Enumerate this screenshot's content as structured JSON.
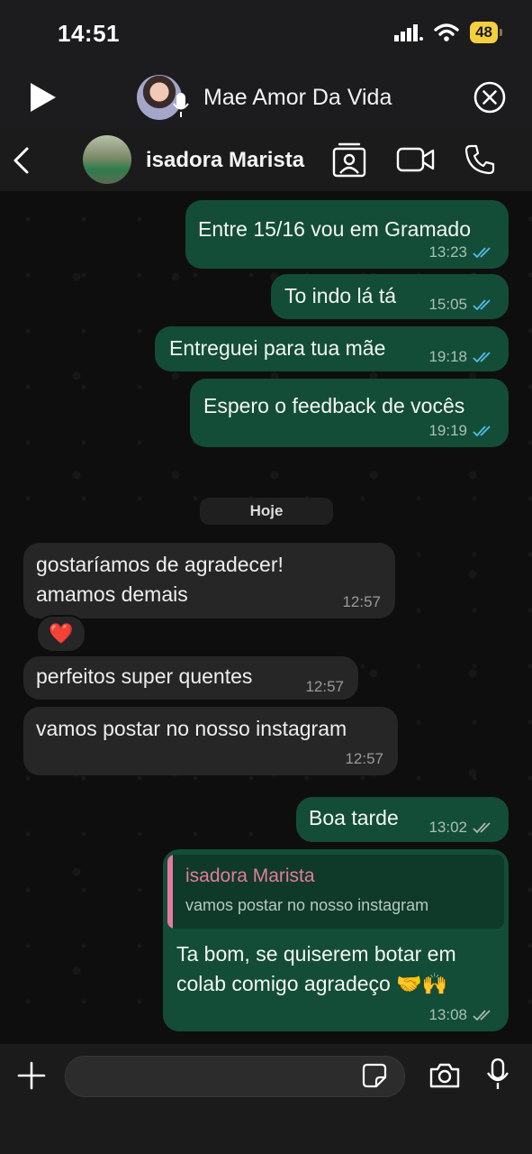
{
  "status_bar": {
    "time": "14:51",
    "battery": "48"
  },
  "call_banner": {
    "name": "Mae Amor Da Vida"
  },
  "header": {
    "contact_name": "isadora Marista"
  },
  "messages": [
    {
      "dir": "out",
      "text": "Entre 15/16 vou em Gramado",
      "time": "13:23",
      "status": "read"
    },
    {
      "dir": "out",
      "text": "To indo lá tá",
      "time": "15:05",
      "status": "read"
    },
    {
      "dir": "out",
      "text": "Entreguei para tua mãe",
      "time": "19:18",
      "status": "read"
    },
    {
      "dir": "out",
      "text": "Espero o feedback de vocês",
      "time": "19:19",
      "status": "read"
    },
    {
      "dir": "in",
      "text": "gostaríamos de agradecer!\namamos demais",
      "time": "12:57",
      "reaction": "❤️"
    },
    {
      "dir": "in",
      "text": "perfeitos super quentes",
      "time": "12:57"
    },
    {
      "dir": "in",
      "text": "vamos postar no nosso instagram",
      "time": "12:57"
    },
    {
      "dir": "out",
      "text": "Boa tarde",
      "time": "13:02",
      "status": "delivered"
    },
    {
      "dir": "out",
      "text": "Ta bom, se quiserem botar em\ncolab comigo agradeço 🤝🙌",
      "time": "13:08",
      "status": "delivered",
      "reply_to": {
        "name": "isadora Marista",
        "text": "vamos postar no nosso instagram"
      }
    }
  ],
  "day_separator": "Hoje",
  "colors": {
    "outgoing_bubble": "#134d37",
    "incoming_bubble": "#262626",
    "read_ticks": "#53bdeb",
    "quote_name": "#e57aa0"
  },
  "icons": [
    "play-icon",
    "mic-icon",
    "close-icon",
    "back-icon",
    "contact-card-icon",
    "video-call-icon",
    "phone-icon",
    "plus-icon",
    "sticker-icon",
    "camera-icon",
    "mic-icon"
  ]
}
